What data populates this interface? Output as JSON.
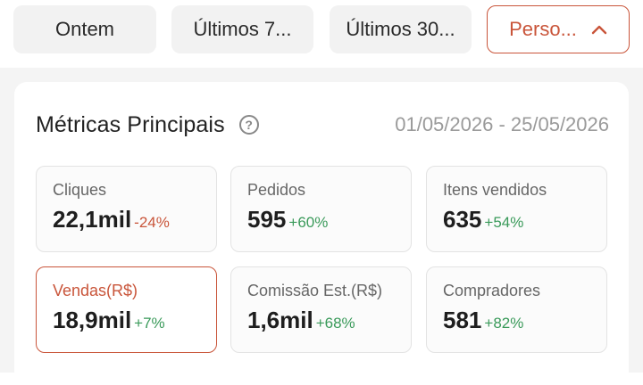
{
  "filters": [
    {
      "label": "Ontem",
      "active": false
    },
    {
      "label": "Últimos 7...",
      "active": false
    },
    {
      "label": "Últimos 30...",
      "active": false
    },
    {
      "label": "Perso...",
      "active": true,
      "icon": "chevron-up-icon"
    }
  ],
  "card": {
    "title": "Métricas Principais",
    "help_icon": "question-circle-icon",
    "date_range": "01/05/2026 - 25/05/2026"
  },
  "metrics": [
    {
      "label": "Cliques",
      "value": "22,1mil",
      "change": "-24%",
      "trend": "down",
      "selected": false
    },
    {
      "label": "Pedidos",
      "value": "595",
      "change": "+60%",
      "trend": "up",
      "selected": false
    },
    {
      "label": "Itens vendidos",
      "value": "635",
      "change": "+54%",
      "trend": "up",
      "selected": false
    },
    {
      "label": "Vendas(R$)",
      "value": "18,9mil",
      "change": "+7%",
      "trend": "up",
      "selected": true
    },
    {
      "label": "Comissão Est.(R$)",
      "value": "1,6mil",
      "change": "+68%",
      "trend": "up",
      "selected": false
    },
    {
      "label": "Compradores",
      "value": "581",
      "change": "+82%",
      "trend": "up",
      "selected": false
    }
  ],
  "colors": {
    "accent": "#c9553a",
    "positive": "#3a9a5a",
    "negative": "#c9553a"
  }
}
